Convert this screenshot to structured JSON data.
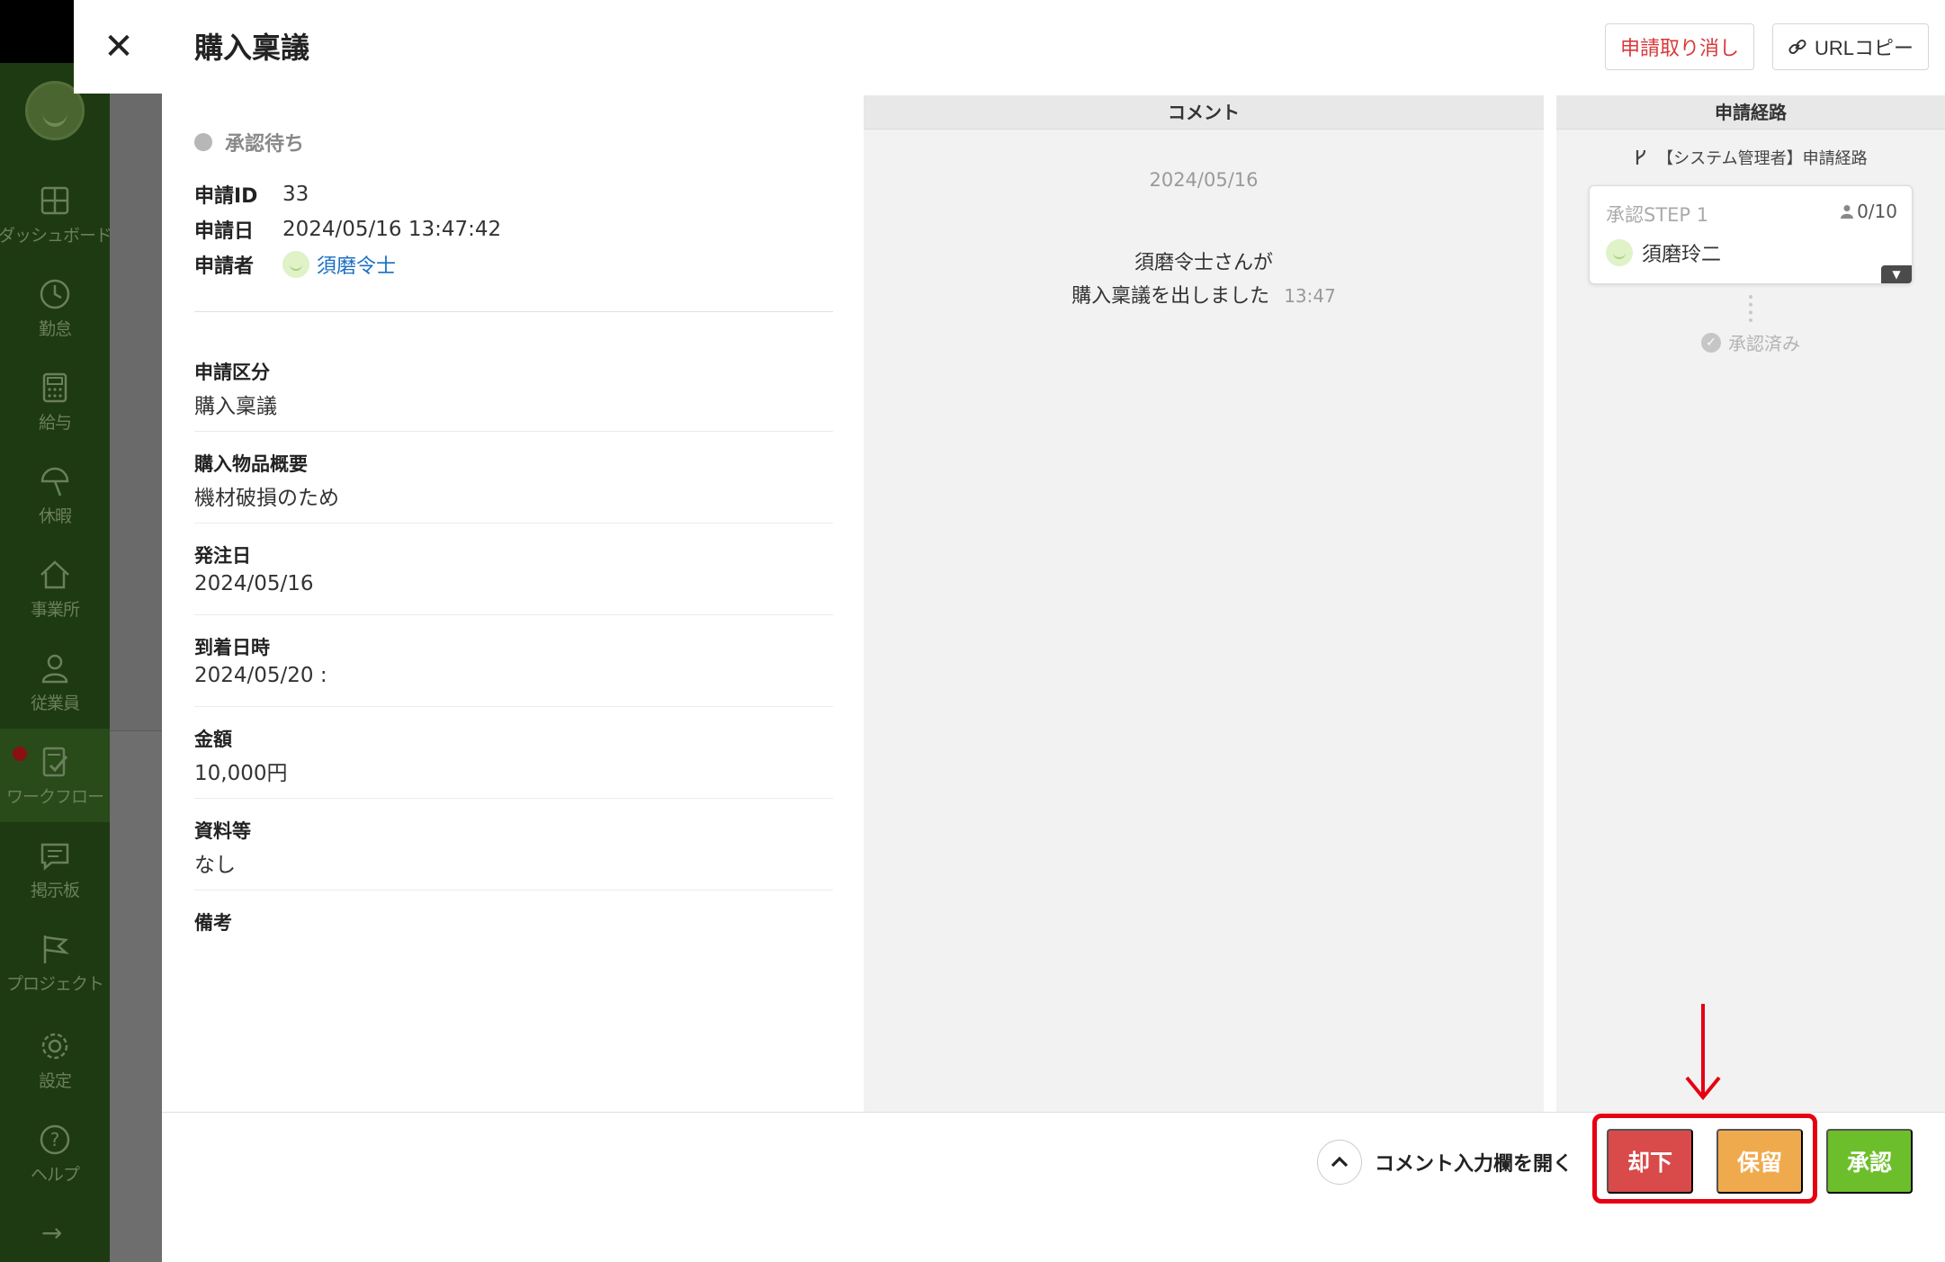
{
  "sidebar": {
    "items": [
      {
        "label": "ダッシュボード",
        "icon": "dashboard-icon"
      },
      {
        "label": "勤怠",
        "icon": "clock-icon"
      },
      {
        "label": "給与",
        "icon": "calculator-icon"
      },
      {
        "label": "休暇",
        "icon": "umbrella-icon"
      },
      {
        "label": "事業所",
        "icon": "home-icon"
      },
      {
        "label": "従業員",
        "icon": "person-icon"
      },
      {
        "label": "ワークフロー",
        "icon": "workflow-icon"
      },
      {
        "label": "掲示板",
        "icon": "message-icon"
      },
      {
        "label": "プロジェクト",
        "icon": "flag-icon"
      },
      {
        "label": "設定",
        "icon": "gear-icon"
      },
      {
        "label": "ヘルプ",
        "icon": "help-icon"
      }
    ],
    "expand_symbol": "→"
  },
  "header": {
    "close_symbol": "✕",
    "title": "購入稟議",
    "cancel_label": "申請取り消し",
    "url_copy_label": "URLコピー"
  },
  "details": {
    "status": "承認待ち",
    "meta": {
      "id_label": "申請ID",
      "id_value": "33",
      "date_label": "申請日",
      "date_value": "2024/05/16 13:47:42",
      "applicant_label": "申請者",
      "applicant_value": "須磨令士"
    },
    "fields": [
      {
        "label": "申請区分",
        "value": "購入稟議"
      },
      {
        "label": "購入物品概要",
        "value": "機材破損のため"
      },
      {
        "label": "発注日",
        "value": "2024/05/16"
      },
      {
        "label": "到着日時",
        "value": "2024/05/20 :"
      },
      {
        "label": "金額",
        "value": "10,000円"
      },
      {
        "label": "資料等",
        "value": "なし"
      },
      {
        "label": "備考",
        "value": ""
      }
    ]
  },
  "comments": {
    "header": "コメント",
    "date": "2024/05/16",
    "message_line1": "須磨令士さんが",
    "message_line2": "購入稟議を出しました",
    "time": "13:47"
  },
  "route": {
    "header": "申請経路",
    "route_name": "【システム管理者】申請経路",
    "step_title": "承認STEP 1",
    "step_count": "0/10",
    "approver": "須磨玲二",
    "approved_label": "承認済み"
  },
  "footer": {
    "open_comment_label": "コメント入力欄を開く",
    "reject_label": "却下",
    "hold_label": "保留",
    "approve_label": "承認"
  },
  "colors": {
    "reject": "#d94a4a",
    "hold": "#f0aa4e",
    "approve": "#6cbf2a",
    "link": "#1a6fc2",
    "highlight": "#e60012"
  }
}
